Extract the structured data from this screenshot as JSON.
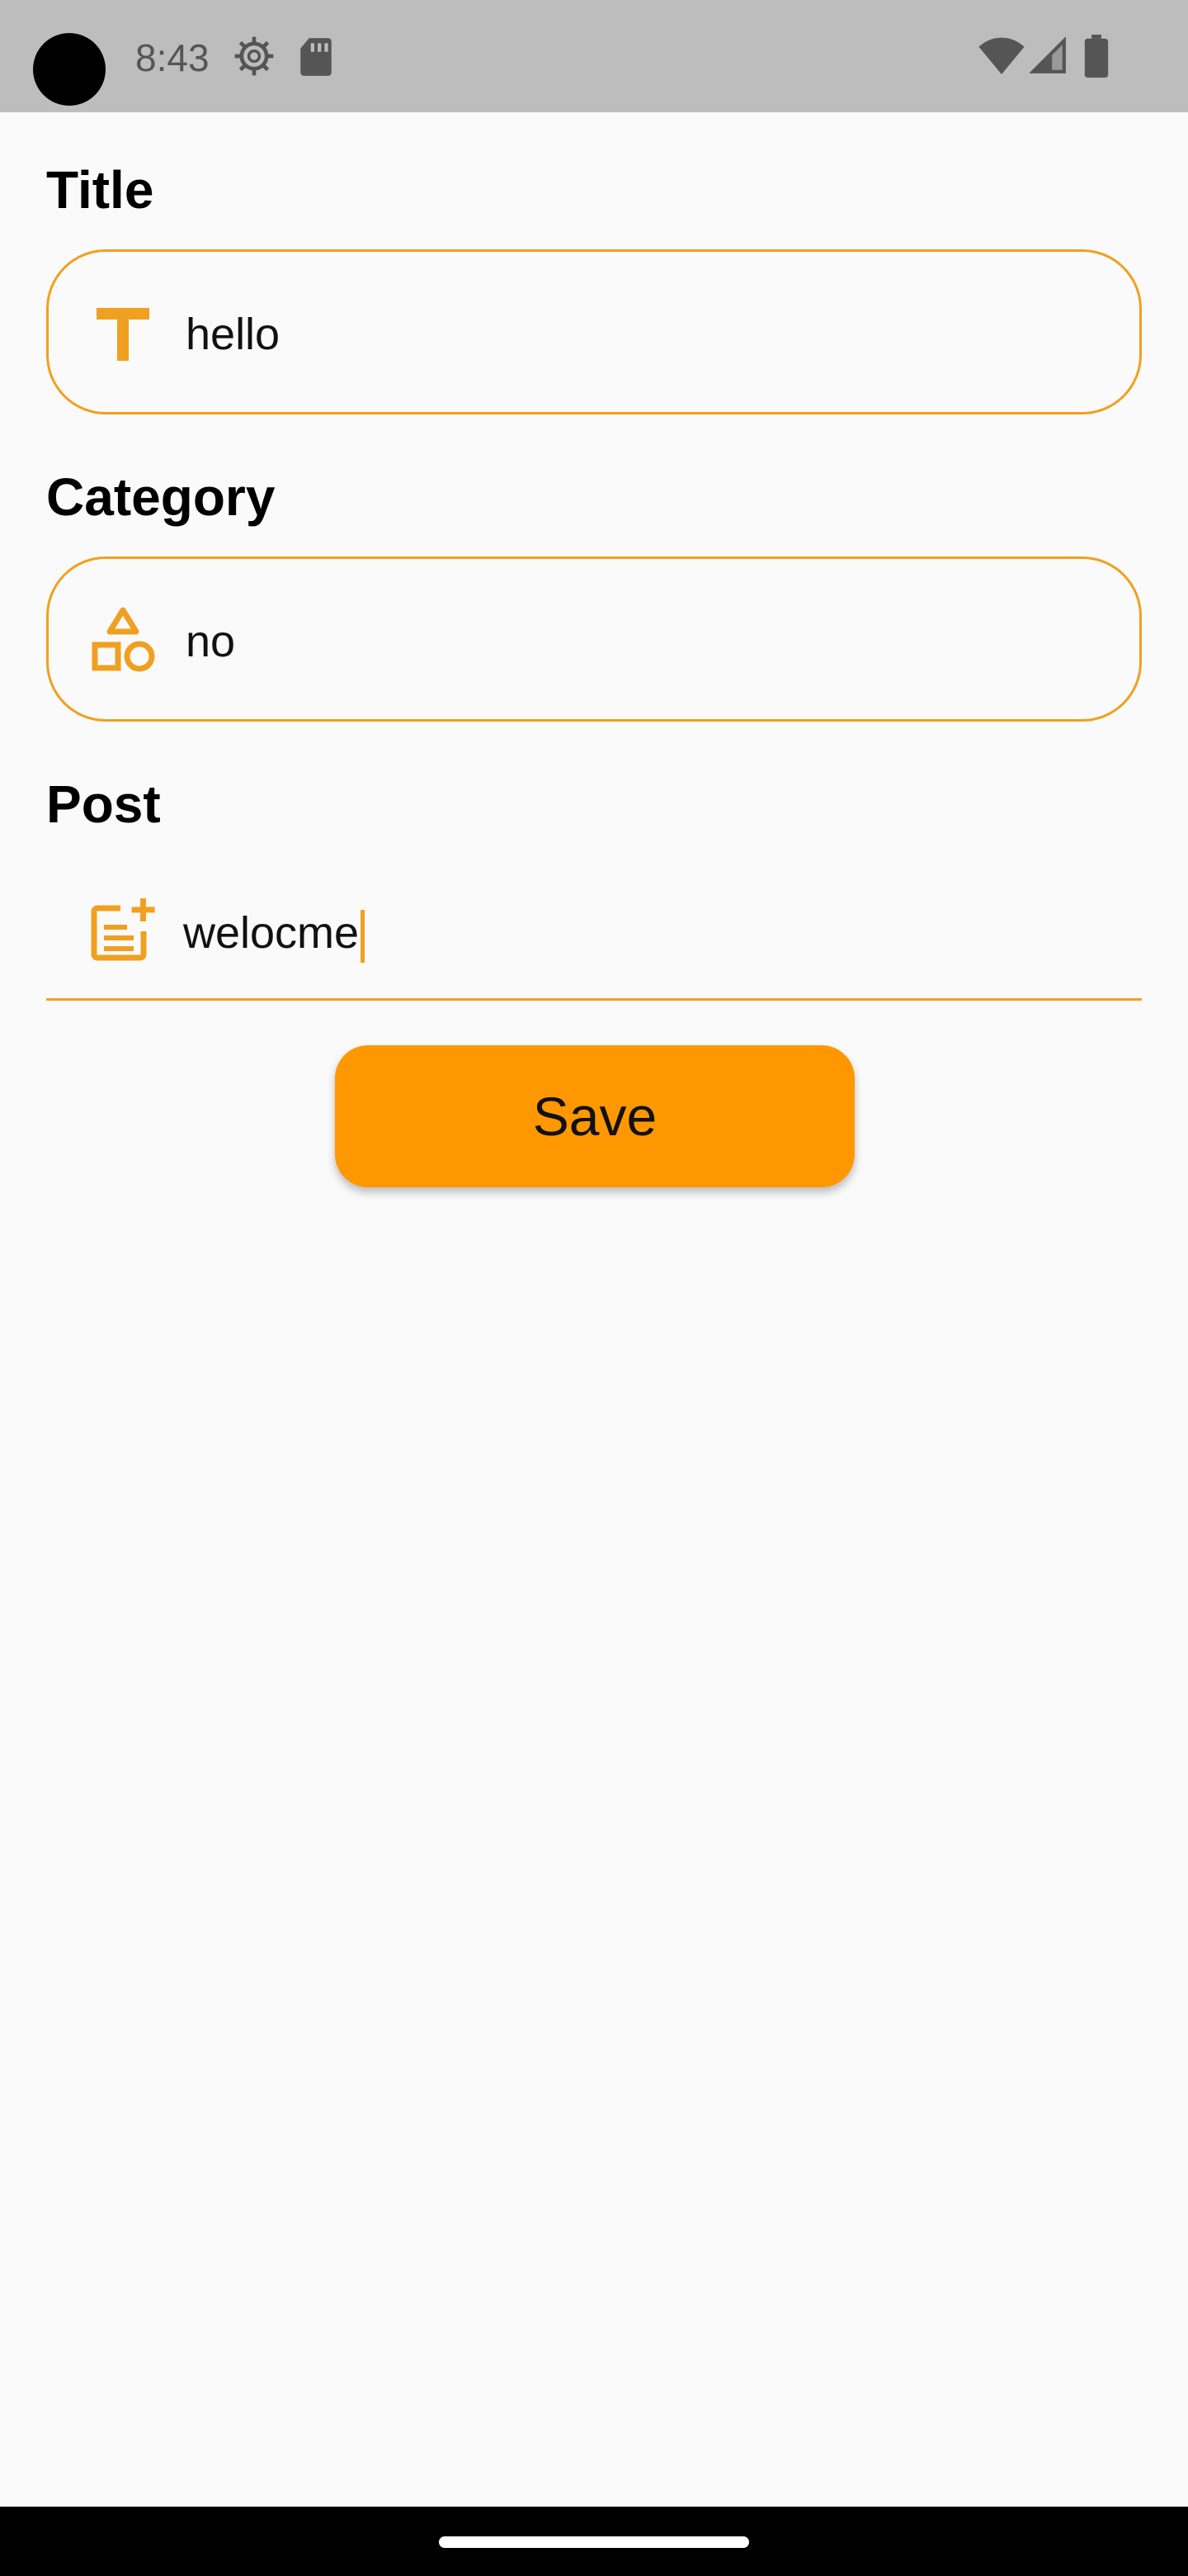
{
  "status_bar": {
    "time": "8:43",
    "icons": [
      "gear-icon",
      "sd-card-icon",
      "wifi-icon",
      "signal-icon",
      "battery-icon"
    ]
  },
  "form": {
    "title_label": "Title",
    "title_value": "hello",
    "title_icon": "text-t-icon",
    "category_label": "Category",
    "category_value": "no",
    "category_icon": "shapes-icon",
    "post_label": "Post",
    "post_value": "welocme",
    "post_icon": "post-add-icon"
  },
  "actions": {
    "save_label": "Save"
  },
  "colors": {
    "accent": "#FF9800",
    "outline": "#F0A020",
    "status_bar": "#BDBDBD",
    "background": "#FAFAFA"
  }
}
